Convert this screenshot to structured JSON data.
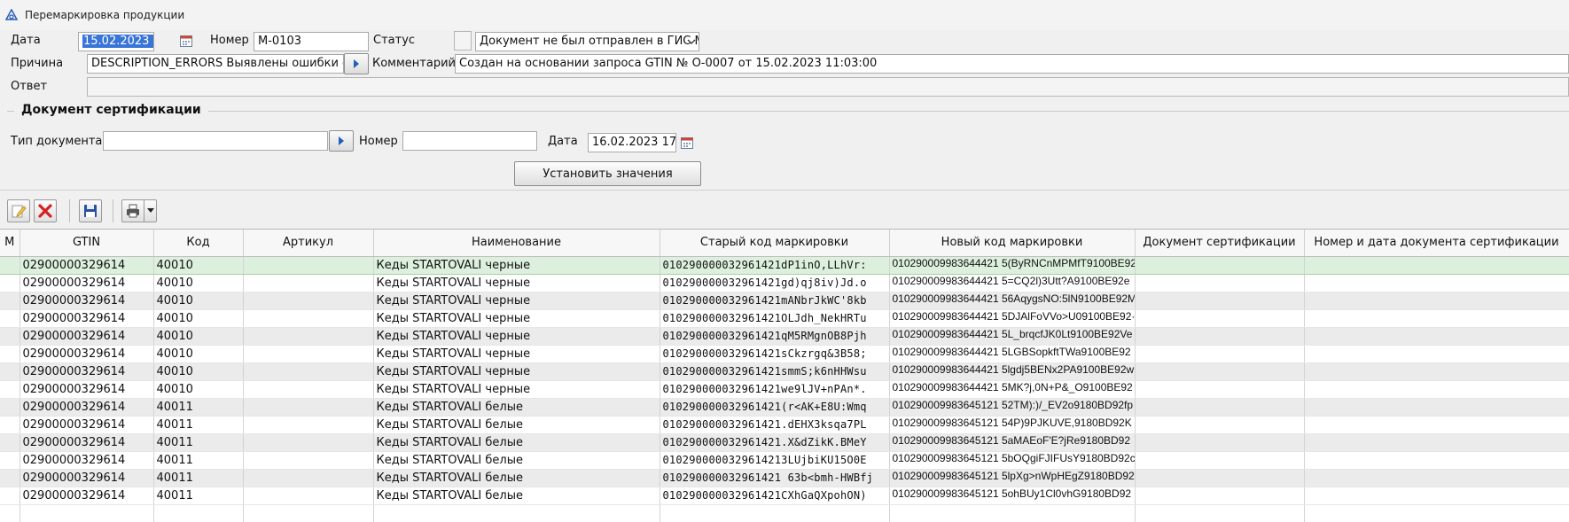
{
  "window": {
    "title": "Перемаркировка продукции"
  },
  "form": {
    "date_label": "Дата",
    "date_value": "15.02.2023 17",
    "number_label": "Номер",
    "number_value": "М-0103",
    "status_label": "Статус",
    "status_value": "Документ не был отправлен в ГИС М",
    "reason_label": "Причина",
    "reason_value": "DESCRIPTION_ERRORS Выявлены ошибки оп",
    "comment_label": "Комментарий",
    "comment_value": "Создан на основании запроса GTIN № О-0007 от 15.02.2023 11:03:00",
    "answer_label": "Ответ",
    "answer_value": ""
  },
  "cert": {
    "group_title": "Документ сертификации",
    "doc_type_label": "Тип документа",
    "doc_type_value": "",
    "number_label": "Номер",
    "number_value": "",
    "date_label": "Дата",
    "date_value": "16.02.2023 17",
    "apply_label": "Установить значения"
  },
  "toolbar": {
    "icons": [
      "edit-icon",
      "delete-icon",
      "save-icon",
      "print-icon"
    ]
  },
  "grid": {
    "columns": [
      "М",
      "GTIN",
      "Код",
      "Артикул",
      "Наименование",
      "Старый код маркировки",
      "Новый код маркировки",
      "Документ сертификации",
      "Номер и дата документа сертификации"
    ],
    "rows": [
      {
        "m": "",
        "gtin": "02900000329614",
        "code": "40010",
        "article": "",
        "name": "Кеды STARTOVALI черные",
        "old": "010290000032961421dP1inO,LLhVr:",
        "new": "010290009983644421 5(ByRNCnMPMfT9100BE92",
        "doc": "",
        "docnum": ""
      },
      {
        "m": "",
        "gtin": "02900000329614",
        "code": "40010",
        "article": "",
        "name": "Кеды STARTOVALI черные",
        "old": "010290000032961421gd)qj8iv)Jd.o",
        "new": "010290009983644421 5=CQ2l)3Utt?A9100BE92e",
        "doc": "",
        "docnum": ""
      },
      {
        "m": "",
        "gtin": "02900000329614",
        "code": "40010",
        "article": "",
        "name": "Кеды STARTOVALI черные",
        "old": "010290000032961421mANbrJkWC'8kb",
        "new": "010290009983644421 56AqygsNO:5lN9100BE92M",
        "doc": "",
        "docnum": ""
      },
      {
        "m": "",
        "gtin": "02900000329614",
        "code": "40010",
        "article": "",
        "name": "Кеды STARTOVALI черные",
        "old": "010290000032961421OLJdh_NekHRTu",
        "new": "010290009983644421 5DJAlFoVVo>U09100BE92·",
        "doc": "",
        "docnum": ""
      },
      {
        "m": "",
        "gtin": "02900000329614",
        "code": "40010",
        "article": "",
        "name": "Кеды STARTOVALI черные",
        "old": "010290000032961421qM5RMgnOB8Pjh",
        "new": "010290009983644421 5L_brqcfJK0Lt9100BE92Ve",
        "doc": "",
        "docnum": ""
      },
      {
        "m": "",
        "gtin": "02900000329614",
        "code": "40010",
        "article": "",
        "name": "Кеды STARTOVALI черные",
        "old": "010290000032961421sCkzrgq&3B58;",
        "new": "010290009983644421 5LGBSopkftTWa9100BE92",
        "doc": "",
        "docnum": ""
      },
      {
        "m": "",
        "gtin": "02900000329614",
        "code": "40010",
        "article": "",
        "name": "Кеды STARTOVALI черные",
        "old": "010290000032961421smmS;k6nHHWsu",
        "new": "010290009983644421 5lgdj5BENx2PA9100BE92w",
        "doc": "",
        "docnum": ""
      },
      {
        "m": "",
        "gtin": "02900000329614",
        "code": "40010",
        "article": "",
        "name": "Кеды STARTOVALI черные",
        "old": "010290000032961421we9lJV+nPAn*.",
        "new": "010290009983644421 5MK?j,0N+P&_O9100BE92",
        "doc": "",
        "docnum": ""
      },
      {
        "m": "",
        "gtin": "02900000329614",
        "code": "40011",
        "article": "",
        "name": "Кеды STARTOVALI белые",
        "old": "010290000032961421(r<AK+E8U:Wmq",
        "new": "010290009983645121 52TM):)/_EV2o9180BD92fp",
        "doc": "",
        "docnum": ""
      },
      {
        "m": "",
        "gtin": "02900000329614",
        "code": "40011",
        "article": "",
        "name": "Кеды STARTOVALI белые",
        "old": "010290000032961421.dEHX3ksqa7PL",
        "new": "010290009983645121 54P)9PJKUVE,9180BD92K",
        "doc": "",
        "docnum": ""
      },
      {
        "m": "",
        "gtin": "02900000329614",
        "code": "40011",
        "article": "",
        "name": "Кеды STARTOVALI белые",
        "old": "010290000032961421.X&dZikK.BMeY",
        "new": "010290009983645121 5aMAEoF'E?jRe9180BD92",
        "doc": "",
        "docnum": ""
      },
      {
        "m": "",
        "gtin": "02900000329614",
        "code": "40011",
        "article": "",
        "name": "Кеды STARTOVALI белые",
        "old": "0102900000329614213LUjbiKU15O0E",
        "new": "010290009983645121 5bOQgiFJIFUsY9180BD92c",
        "doc": "",
        "docnum": ""
      },
      {
        "m": "",
        "gtin": "02900000329614",
        "code": "40011",
        "article": "",
        "name": "Кеды STARTOVALI белые",
        "old": "010290000032961421 63b<bmh-HWBfj",
        "new": "010290009983645121 5lpXg>nWpHEgZ9180BD92",
        "doc": "",
        "docnum": ""
      },
      {
        "m": "",
        "gtin": "02900000329614",
        "code": "40011",
        "article": "",
        "name": "Кеды STARTOVALI белые",
        "old": "010290000032961421CXhGaQXpohON)",
        "new": "010290009983645121 5ohBUy1Cl0vhG9180BD92",
        "doc": "",
        "docnum": ""
      }
    ]
  },
  "colors": {
    "selected_row": "#ddf0dd",
    "selection_highlight": "#3875d7",
    "window_bg": "#f0f0f0"
  }
}
